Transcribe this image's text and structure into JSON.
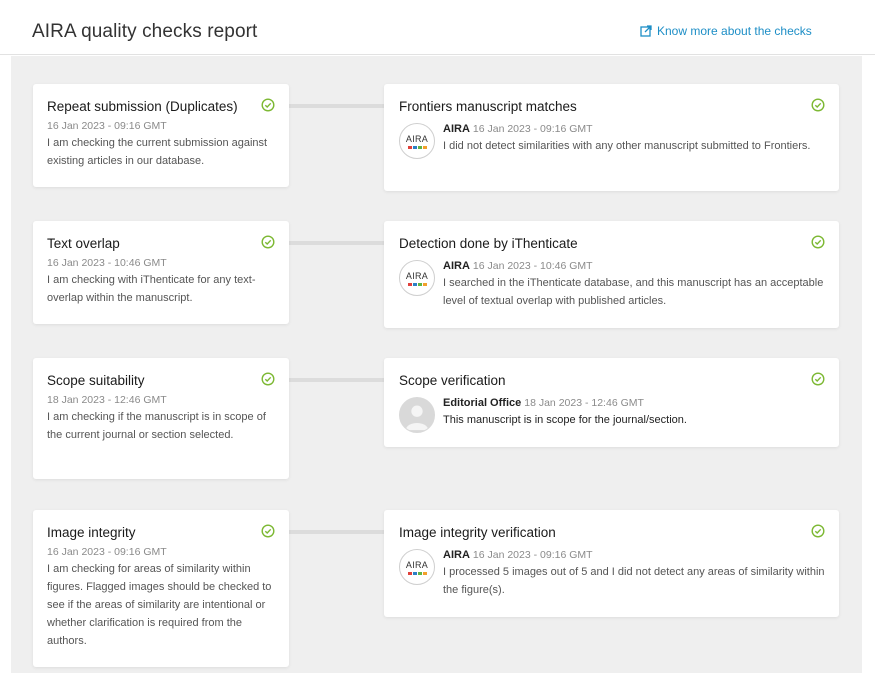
{
  "header": {
    "title": "AIRA quality checks report",
    "link_label": "Know more about the checks"
  },
  "colors": {
    "accent": "#1d8ec6",
    "check": "#7cb832",
    "dot_red": "#e0413b",
    "dot_blue": "#2b7fc5",
    "dot_green": "#5fb346",
    "dot_orange": "#f2a02b"
  },
  "checks": [
    {
      "title": "Repeat submission (Duplicates)",
      "timestamp": "16 Jan 2023 - 09:16 GMT",
      "description": "I am checking the current submission against existing articles in our database.",
      "status_icon": "check-circle-icon",
      "verification": {
        "title": "Frontiers manuscript matches",
        "author": "AIRA",
        "avatar": "aira-logo",
        "timestamp": "16 Jan 2023 - 09:16 GMT",
        "text": "I did not detect similarities with any other manuscript submitted to Frontiers."
      }
    },
    {
      "title": "Text overlap",
      "timestamp": "16 Jan 2023 - 10:46 GMT",
      "description": "I am checking with iThenticate for any text-overlap within the manuscript.",
      "status_icon": "check-circle-icon",
      "verification": {
        "title": "Detection done by iThenticate",
        "author": "AIRA",
        "avatar": "aira-logo",
        "timestamp": "16 Jan 2023 - 10:46 GMT",
        "text": "I searched in the iThenticate database, and this manuscript has an acceptable level of textual overlap with published articles."
      }
    },
    {
      "title": "Scope suitability",
      "timestamp": "18 Jan 2023 - 12:46 GMT",
      "description": "I am checking if the manuscript is in scope of the current journal or section selected.",
      "status_icon": "check-circle-icon",
      "verification": {
        "title": "Scope verification",
        "author": "Editorial Office",
        "avatar": "person-placeholder",
        "timestamp": "18 Jan 2023 - 12:46 GMT",
        "text": "This manuscript is in scope for the journal/section."
      }
    },
    {
      "title": "Image integrity",
      "timestamp": "16 Jan 2023 - 09:16 GMT",
      "description": "I am checking for areas of similarity within figures. Flagged images should be checked to see if the areas of similarity are intentional or whether clarification is required from the authors.",
      "status_icon": "check-circle-icon",
      "verification": {
        "title": "Image integrity verification",
        "author": "AIRA",
        "avatar": "aira-logo",
        "timestamp": "16 Jan 2023 - 09:16 GMT",
        "text": "I processed 5 images out of 5 and I did not detect any areas of similarity within the figure(s)."
      }
    }
  ]
}
